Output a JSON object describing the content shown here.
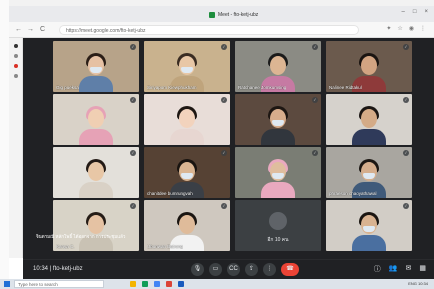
{
  "browser": {
    "tab_title": "Meet - fto-ketj-ubz",
    "url": "https://meet.google.com/fto-ketj-ubz",
    "nav_back": "←",
    "nav_forward": "→",
    "nav_reload": "C"
  },
  "participants": [
    {
      "name": "Gig pueksa",
      "bg": "#b7a389",
      "skin": "#e6c1a4",
      "hair": "#2b1e17",
      "shirt": "#5f7fa8",
      "mask": true
    },
    {
      "name": "Siriyapom Kiewphukham",
      "bg": "#c9b28e",
      "skin": "#e8c7a6",
      "hair": "#3a2c22",
      "shirt": "#bfa47c",
      "mask": true
    },
    {
      "name": "Ratchanee Jomkumsing",
      "bg": "#8b8b84",
      "skin": "#dcb593",
      "hair": "#1b1b1b",
      "shirt": "#c67aa3",
      "mask": false
    },
    {
      "name": "Nalinee Ridtakul",
      "bg": "#6b5a4d",
      "skin": "#d2a482",
      "hair": "#1a1411",
      "shirt": "#8e3a3a",
      "mask": false
    },
    {
      "name": "",
      "bg": "#d9d2c8",
      "skin": "#f0cfb3",
      "hair": "#e6a2b6",
      "shirt": "#e6a2b6",
      "mask": false
    },
    {
      "name": "",
      "bg": "#e8ddd8",
      "skin": "#f2d3bd",
      "hair": "#1d1612",
      "shirt": "#e7d6d1",
      "mask": false
    },
    {
      "name": "",
      "bg": "#5c4a3f",
      "skin": "#d7ad8c",
      "hair": "#1d1612",
      "shirt": "#31363d",
      "mask": true
    },
    {
      "name": "",
      "bg": "#d6d2cc",
      "skin": "#d4ab87",
      "hair": "#1b1613",
      "shirt": "#2f3a5a",
      "mask": false
    },
    {
      "name": "",
      "bg": "#e3e0da",
      "skin": "#e8c7a6",
      "hair": "#231a15",
      "shirt": "#d9d1c6",
      "mask": false
    },
    {
      "name": "chanitdee bumrungvah",
      "bg": "#564234",
      "skin": "#dab592",
      "hair": "#191410",
      "shirt": "#3a3f46",
      "mask": true
    },
    {
      "name": "",
      "bg": "#7a7d74",
      "skin": "#dfbd9e",
      "hair": "#e9a9bf",
      "shirt": "#e9a9bf",
      "mask": true
    },
    {
      "name": "phraeson chaoyathawal",
      "bg": "#a9a6a0",
      "skin": "#d5ae8d",
      "hair": "#1c1713",
      "shirt": "#3f5a7a",
      "mask": true
    },
    {
      "name": "Kanya C.",
      "bg": "#d8d3c7",
      "skin": "#e5c2a3",
      "hair": "#251c16",
      "shirt": "#c9c2b4",
      "mask": false
    },
    {
      "name": "Ubonwan Butrong",
      "bg": "#cfc8bf",
      "skin": "#dfbb9a",
      "hair": "#1a1511",
      "shirt": "#f2f2f2",
      "mask": false
    },
    {
      "name": "",
      "bg": "#d2cdc6",
      "skin": "#d9b391",
      "hair": "#1a1511",
      "shirt": "#4a6fa0",
      "mask": true
    }
  ],
  "others": {
    "count_label": "อีก 10 คน"
  },
  "caption": {
    "text": "จินดามณี หลักโพธิ์ ได้ออกจาก การประชุมแล้ว"
  },
  "meeting": {
    "time_and_code": "10:34 | fto-ketj-ubz"
  },
  "controls": {
    "mic": "🎙",
    "cam": "▭",
    "captions": "CC",
    "present": "⇪",
    "more": "⋮",
    "end": "☎"
  },
  "right_controls": {
    "info": "ⓘ",
    "people": "👥",
    "chat": "✉",
    "activities": "▦"
  },
  "taskbar": {
    "search_placeholder": "Type here to search",
    "tray": "ENG 10:34"
  },
  "colors": {
    "meet_bg": "#202124",
    "end_call": "#ea4335",
    "chrome_bg": "#e9eaed"
  }
}
